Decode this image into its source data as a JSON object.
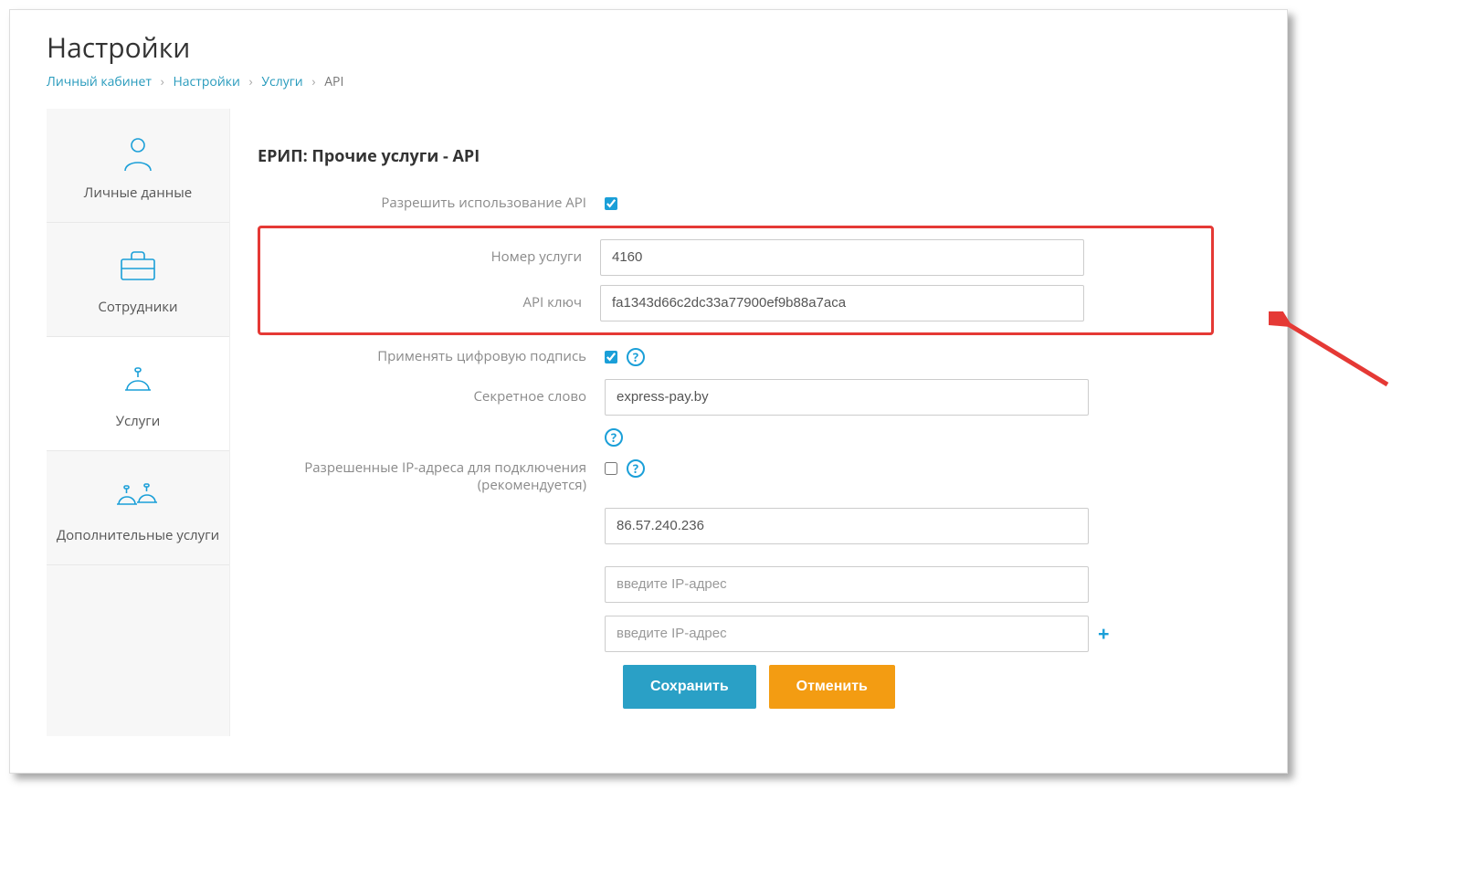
{
  "page_title": "Настройки",
  "breadcrumb": {
    "items": [
      "Личный кабинет",
      "Настройки",
      "Услуги"
    ],
    "current": "API"
  },
  "sidebar": {
    "items": [
      {
        "label": "Личные данные",
        "active": false
      },
      {
        "label": "Сотрудники",
        "active": false
      },
      {
        "label": "Услуги",
        "active": true
      },
      {
        "label": "Дополнительные услуги",
        "active": false
      }
    ]
  },
  "section_title": "ЕРИП: Прочие услуги - API",
  "form": {
    "allow_api_label": "Разрешить использование API",
    "allow_api_checked": true,
    "service_number_label": "Номер услуги",
    "service_number_value": "4160",
    "api_key_label": "API ключ",
    "api_key_value": "fa1343d66c2dc33a77900ef9b88a7aca",
    "digital_sign_label": "Применять цифровую подпись",
    "digital_sign_checked": true,
    "secret_label": "Секретное слово",
    "secret_value": "express-pay.by",
    "allowed_ip_label": "Разрешенные IP-адреса для подключения (рекомендуется)",
    "allowed_ip_checked": false,
    "ip_values": [
      "86.57.240.236"
    ],
    "ip_placeholder": "введите IP-адрес",
    "save_label": "Сохранить",
    "cancel_label": "Отменить"
  }
}
